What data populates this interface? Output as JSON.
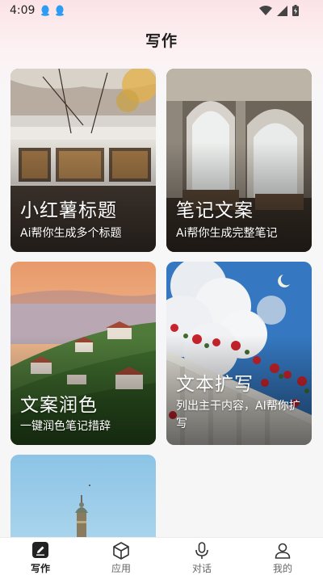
{
  "status_bar": {
    "time": "4:09"
  },
  "page": {
    "title": "写作"
  },
  "cards": [
    {
      "title": "小红薯标题",
      "subtitle": "Ai帮你生成多个标题"
    },
    {
      "title": "笔记文案",
      "subtitle": "Ai帮你生成完整笔记"
    },
    {
      "title": "文案润色",
      "subtitle": "一键润色笔记措辞"
    },
    {
      "title": "文本扩写",
      "subtitle": "列出主干内容，AI帮你扩写"
    },
    {
      "title": "",
      "subtitle": ""
    }
  ],
  "tabs": [
    {
      "label": "写作",
      "icon": "pen-icon",
      "active": true
    },
    {
      "label": "应用",
      "icon": "cube-icon",
      "active": false
    },
    {
      "label": "对话",
      "icon": "microphone-icon",
      "active": false
    },
    {
      "label": "我的",
      "icon": "person-icon",
      "active": false
    }
  ]
}
